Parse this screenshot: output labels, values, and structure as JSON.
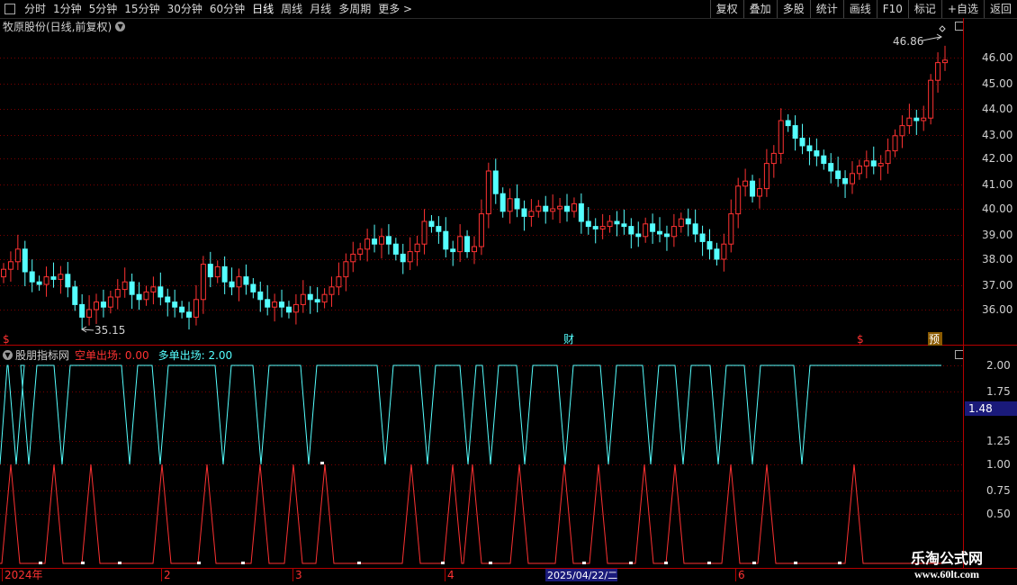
{
  "toolbar": {
    "periods": [
      "分时",
      "1分钟",
      "5分钟",
      "15分钟",
      "30分钟",
      "60分钟",
      "日线",
      "周线",
      "月线",
      "多周期",
      "更多 >"
    ],
    "active_period": "日线",
    "actions": [
      "复权",
      "叠加",
      "多股",
      "统计",
      "画线",
      "F10",
      "标记",
      "+自选",
      "返回"
    ]
  },
  "main_chart": {
    "title": "牧原股份(日线,前复权)",
    "price_ticks": [
      "46.00",
      "45.00",
      "44.00",
      "43.00",
      "42.00",
      "41.00",
      "40.00",
      "39.00",
      "38.00",
      "37.00",
      "36.00"
    ],
    "high_label": "46.86",
    "low_label": "35.15",
    "markers": {
      "dollar1": "$",
      "cai": "财",
      "dollar2": "$",
      "yu": "预"
    }
  },
  "indicator": {
    "name": "股朋指标网",
    "short_label": "空单出场: 0.00",
    "long_label": "多单出场: 2.00",
    "ticks": [
      "2.00",
      "1.75",
      "1.25",
      "1.00",
      "0.75",
      "0.50"
    ],
    "cursor_value": "1.48"
  },
  "time_axis": {
    "labels": [
      "2024年",
      "2",
      "3",
      "4",
      "6"
    ],
    "cursor_date": "2025/04/22/二"
  },
  "watermark": {
    "line1": "乐淘公式网",
    "line2": "www.60lt.com"
  },
  "colors": {
    "up": "#ff3232",
    "down": "#55ffff",
    "grid": "#7a0000",
    "axis": "#b40000"
  }
}
